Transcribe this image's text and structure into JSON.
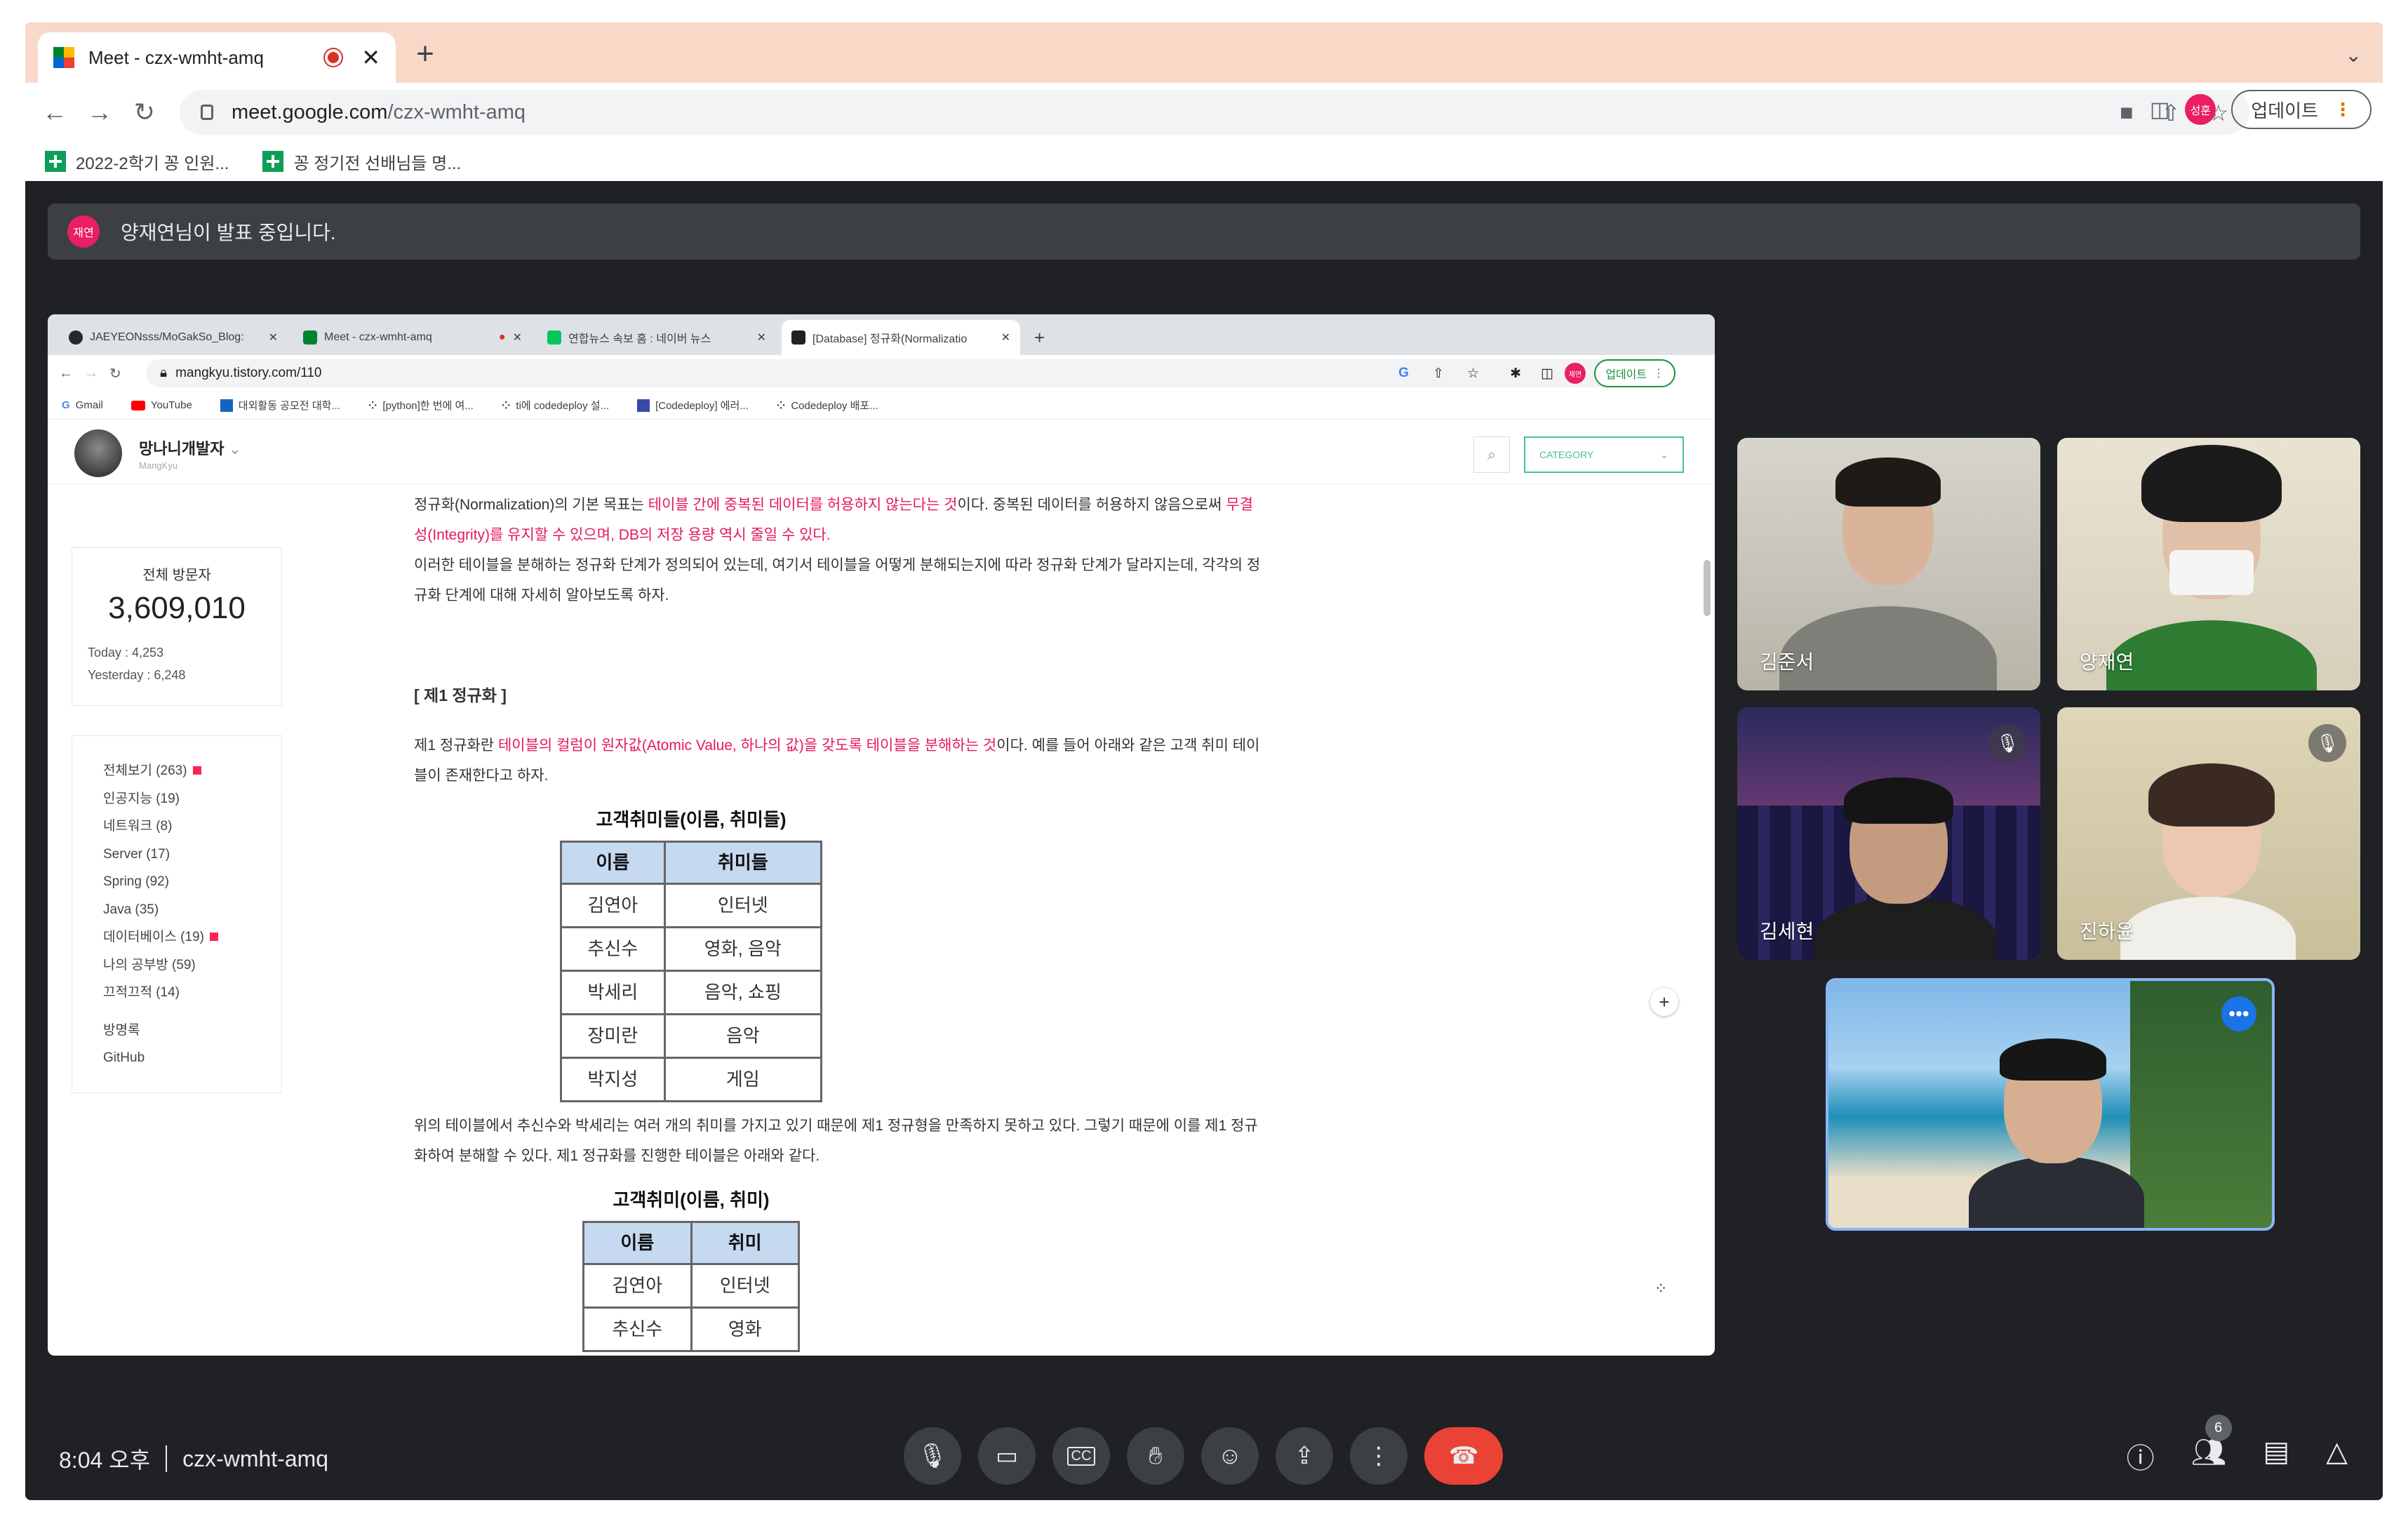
{
  "browser": {
    "tab_title": "Meet - czx-wmht-amq",
    "url_host": "meet.google.com",
    "url_path": "/czx-wmht-amq",
    "update_label": "업데이트",
    "profile_initials": "성훈",
    "bookmarks": [
      "2022-2학기 꽁 인원...",
      "꽁 정기전 선배님들 명..."
    ]
  },
  "meet": {
    "banner_avatar": "재연",
    "banner_text": "양재연님이 발표 중입니다.",
    "time": "8:04 오후",
    "meeting_code": "czx-wmht-amq",
    "participant_count": "6",
    "participants": [
      "김준서",
      "양재연",
      "김세현",
      "진하윤"
    ]
  },
  "shared": {
    "tabs": [
      "JAEYEONsss/MoGakSo_Blog:",
      "Meet - czx-wmht-amq",
      "연합뉴스 속보 홈 : 네이버 뉴스",
      "[Database] 정규화(Normalizatio"
    ],
    "url": "mangkyu.tistory.com/110",
    "update_label": "업데이트",
    "profile": "재연",
    "bookmarks": [
      "Gmail",
      "YouTube",
      "대외활동 공모전 대학...",
      "[python]한 번에 여...",
      "ti에 codedeploy 설...",
      "[Codedeploy] 에러...",
      "Codedeploy 배포..."
    ]
  },
  "blog": {
    "name": "망나니개발자",
    "sub": "MangKyu",
    "category_label": "CATEGORY",
    "visitors_label": "전체 방문자",
    "visitors_total": "3,609,010",
    "today": "Today : 4,253",
    "yesterday": "Yesterday : 6,248",
    "categories": [
      "전체보기 (263)",
      "인공지능 (19)",
      "네트워크 (8)",
      "Server (17)",
      "Spring (92)",
      "Java (35)",
      "데이터베이스 (19)",
      "나의 공부방 (59)",
      "끄적끄적 (14)"
    ],
    "extra_links": [
      "방명록",
      "GitHub"
    ],
    "p1a": "정규화(Normalization)의 기본 목표는 ",
    "p1red": "테이블 간에 중복된 데이터를 허용하지 않는다는 것",
    "p1b": "이다. 중복된 데이터를 허용하지 않음으로써 ",
    "p1red2": "무결",
    "p1red3": "성(Integrity)를 유지할 수 있으며, DB의 저장 용량 역시 줄일 수 있다.",
    "p2": "이러한 테이블을 분해하는 정규화 단계가 정의되어 있는데, 여기서 테이블을 어떻게 분해되는지에 따라 정규화 단계가 달라지는데, 각각의 정",
    "p2b": "규화 단계에 대해 자세히 알아보도록 하자.",
    "h_nf1": "[ 제1 정규화 ]",
    "p3a": "제1 정규화란 ",
    "p3red": "테이블의 컬럼이 원자값(Atomic Value, 하나의 값)을 갖도록 테이블을 분해하는 것",
    "p3b": "이다. 예를 들어 아래와 같은 고객 취미 테이",
    "p3c": "블이 존재한다고 하자.",
    "table1_title": "고객취미들(이름, 취미들)",
    "table1_headers": [
      "이름",
      "취미들"
    ],
    "table1_rows": [
      [
        "김연아",
        "인터넷"
      ],
      [
        "추신수",
        "영화, 음악"
      ],
      [
        "박세리",
        "음악, 쇼핑"
      ],
      [
        "장미란",
        "음악"
      ],
      [
        "박지성",
        "게임"
      ]
    ],
    "p4": "위의 테이블에서 추신수와 박세리는 여러 개의 취미를 가지고 있기 때문에 제1 정규형을 만족하지 못하고 있다. 그렇기 때문에 이를 제1 정규",
    "p4b": "화하여 분해할 수 있다. 제1 정규화를 진행한 테이블은 아래와 같다.",
    "table2_title": "고객취미(이름, 취미)",
    "table2_headers": [
      "이름",
      "취미"
    ],
    "table2_rows": [
      [
        "김연아",
        "인터넷"
      ],
      [
        "추신수",
        "영화"
      ]
    ]
  }
}
